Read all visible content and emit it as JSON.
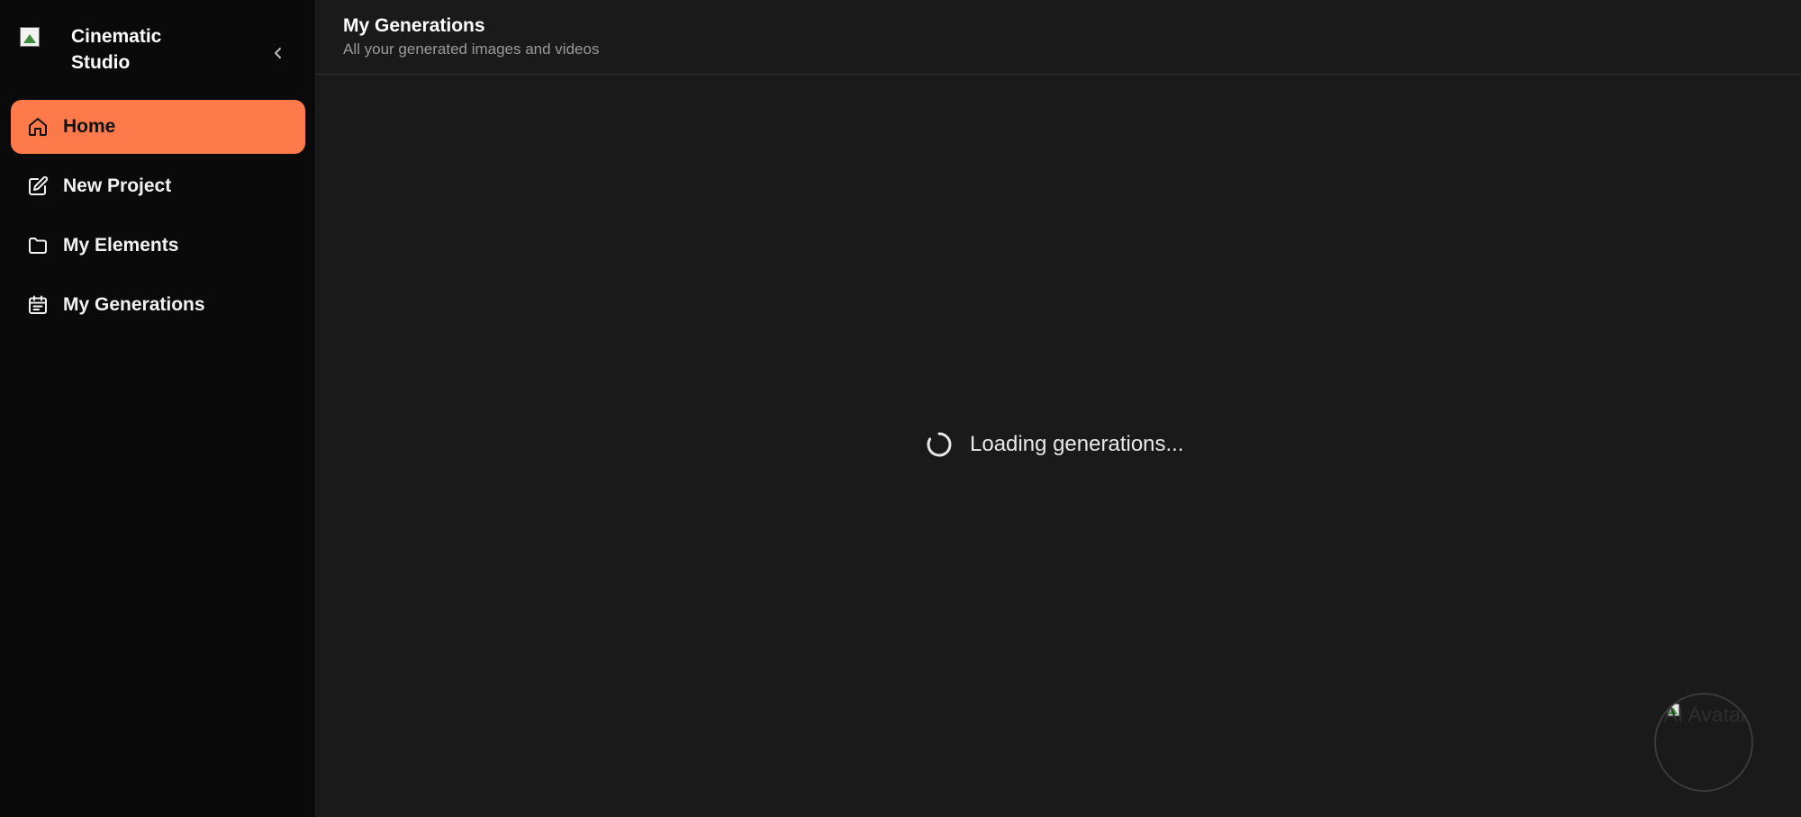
{
  "brand": {
    "name": "Cinematic Studio"
  },
  "sidebar": {
    "items": [
      {
        "label": "Home",
        "icon": "home-icon",
        "active": true
      },
      {
        "label": "New Project",
        "icon": "edit-icon",
        "active": false
      },
      {
        "label": "My Elements",
        "icon": "folder-icon",
        "active": false
      },
      {
        "label": "My Generations",
        "icon": "calendar-icon",
        "active": false
      }
    ]
  },
  "header": {
    "title": "My Generations",
    "subtitle": "All your generated images and videos"
  },
  "main": {
    "loading_text": "Loading generations..."
  },
  "avatar": {
    "alt": "AI Avatar"
  },
  "colors": {
    "accent": "#ff7a4a",
    "sidebar_bg": "#0b0a0a",
    "main_bg": "#1a1a1a"
  }
}
